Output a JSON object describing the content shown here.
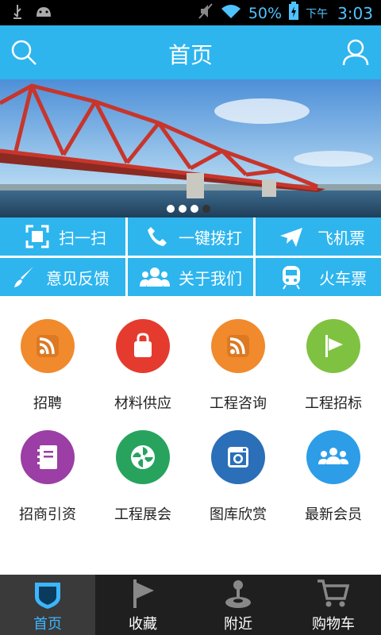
{
  "status_bar": {
    "battery_percent": "50%",
    "ampm": "下午",
    "time": "3:03",
    "icons": [
      "usb-icon",
      "android-icon",
      "mute-icon",
      "wifi-icon",
      "battery-charging-icon"
    ]
  },
  "header": {
    "title": "首页",
    "left_icon": "search-icon",
    "right_icon": "user-icon"
  },
  "banner": {
    "slide_count": 4,
    "active_index": 3
  },
  "quick_actions": [
    {
      "label": "扫一扫",
      "icon": "scan-icon"
    },
    {
      "label": "一键拨打",
      "icon": "phone-icon"
    },
    {
      "label": "飞机票",
      "icon": "airplane-icon"
    },
    {
      "label": "意见反馈",
      "icon": "feedback-brush-icon"
    },
    {
      "label": "关于我们",
      "icon": "group-icon"
    },
    {
      "label": "火车票",
      "icon": "train-icon"
    }
  ],
  "apps": [
    {
      "label": "招聘",
      "icon": "rss-icon",
      "color": "#f08a2c"
    },
    {
      "label": "材料供应",
      "icon": "shopping-bag-icon",
      "color": "#e53b2f"
    },
    {
      "label": "工程咨询",
      "icon": "rss-icon",
      "color": "#f08a2c"
    },
    {
      "label": "工程招标",
      "icon": "flag-icon",
      "color": "#7fc241"
    },
    {
      "label": "招商引资",
      "icon": "notebook-icon",
      "color": "#9b3ea5"
    },
    {
      "label": "工程展会",
      "icon": "pinwheel-icon",
      "color": "#27a35e"
    },
    {
      "label": "图库欣赏",
      "icon": "camera-icon",
      "color": "#2a6fb8"
    },
    {
      "label": "最新会员",
      "icon": "members-icon",
      "color": "#2d9de8"
    }
  ],
  "bottom_nav": [
    {
      "label": "首页",
      "icon": "home-shield-icon",
      "active": true
    },
    {
      "label": "收藏",
      "icon": "flag-icon",
      "active": false
    },
    {
      "label": "附近",
      "icon": "joystick-icon",
      "active": false
    },
    {
      "label": "购物车",
      "icon": "cart-icon",
      "active": false
    }
  ],
  "colors": {
    "primary": "#2eb5ee",
    "active_tab_text": "#3cb6ff",
    "nav_bg": "#1f1f1f"
  }
}
